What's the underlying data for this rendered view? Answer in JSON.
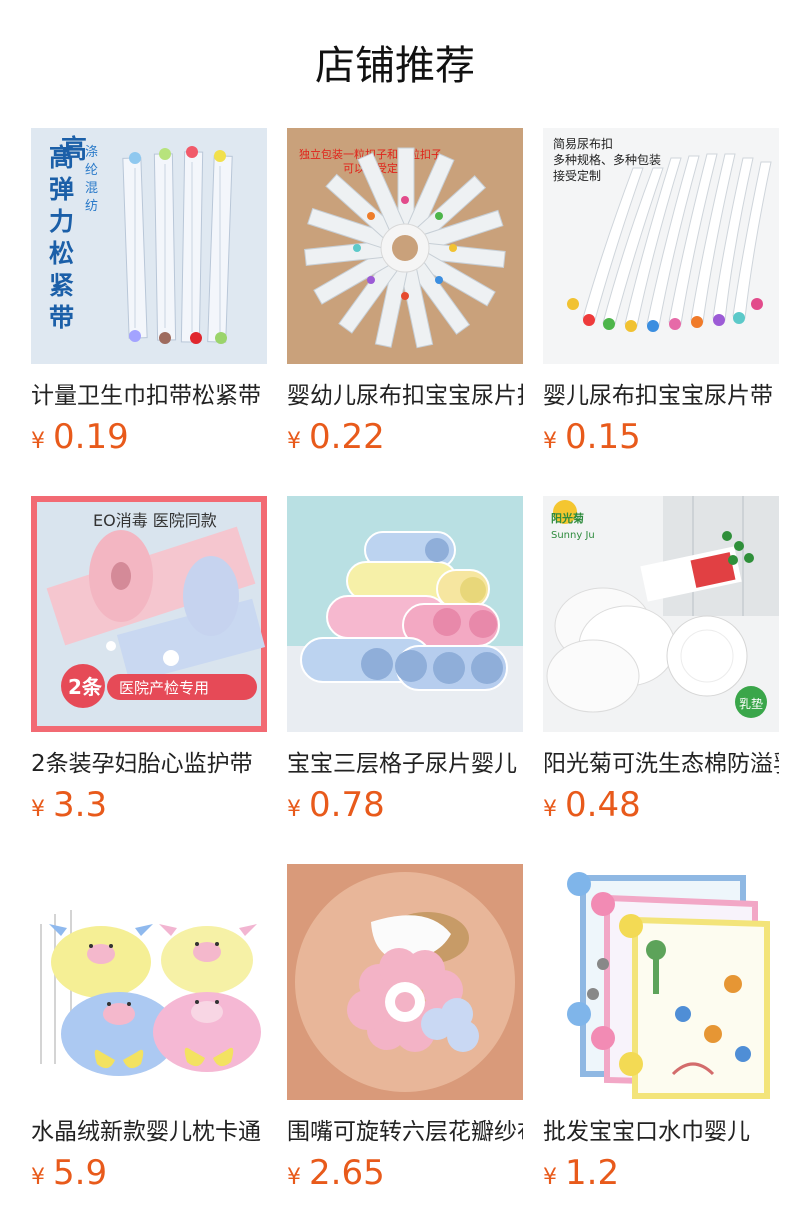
{
  "page": {
    "title": "店铺推荐"
  },
  "currency_symbol": "¥",
  "colors": {
    "price": "#e85a1b",
    "text": "#222222"
  },
  "products": [
    {
      "name": "计量卫生巾扣带松紧带",
      "price": "0.19",
      "image": "elastic-belts-image",
      "image_text": [
        "高弹力松紧带",
        "涤纶混纺"
      ]
    },
    {
      "name": "婴幼儿尿布扣宝宝尿片扣",
      "price": "0.22",
      "image": "diaper-buckles-fan-image",
      "image_text": [
        "独立包装一粒扣子和二粒扣子",
        "可以接受定做"
      ]
    },
    {
      "name": "婴儿尿布扣宝宝尿片带",
      "price": "0.15",
      "image": "diaper-straps-hanging-image",
      "image_text": [
        "简易尿布扣",
        "多种规格、多种包装",
        "接受定制"
      ]
    },
    {
      "name": "2条装孕妇胎心监护带",
      "price": "3.3",
      "image": "fetal-monitor-belt-image",
      "image_text": [
        "EO消毒  医院同款",
        "2条",
        "医院产检专用"
      ]
    },
    {
      "name": "宝宝三层格子尿片婴儿",
      "price": "0.78",
      "image": "cloth-diapers-stack-image",
      "image_text": []
    },
    {
      "name": "阳光菊可洗生态棉防溢乳垫",
      "price": "0.48",
      "image": "nursing-pads-image",
      "image_text": [
        "阳光菊",
        "Sunny Ju",
        "乳垫"
      ]
    },
    {
      "name": "水晶绒新款婴儿枕卡通",
      "price": "5.9",
      "image": "pig-pillows-image",
      "image_text": []
    },
    {
      "name": "围嘴可旋转六层花瓣纱布",
      "price": "2.65",
      "image": "petal-bibs-image",
      "image_text": []
    },
    {
      "name": "批发宝宝口水巾婴儿",
      "price": "1.2",
      "image": "bibs-stack-image",
      "image_text": []
    }
  ]
}
